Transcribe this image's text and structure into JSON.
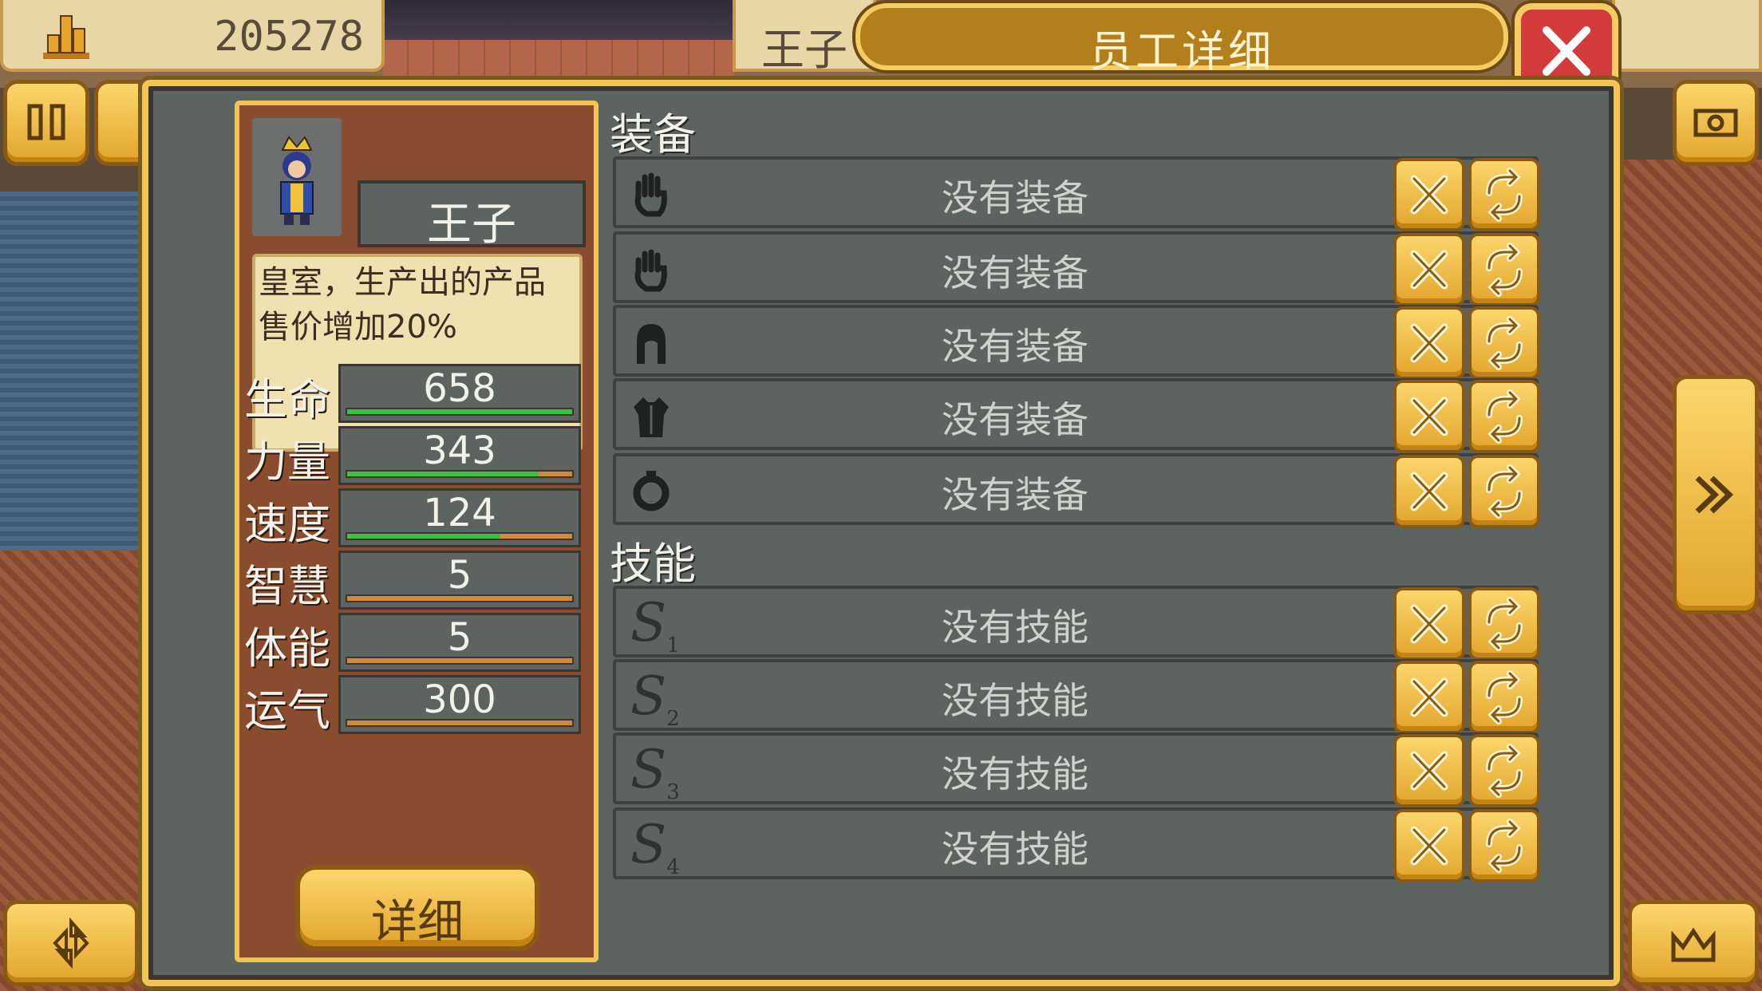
{
  "top_bar": {
    "money": "205278",
    "name_tab": "王子",
    "dialog_title": "员工详细"
  },
  "character": {
    "name": "王子",
    "description": "皇室，生产出的产品售价增加20%",
    "stats": [
      {
        "label": "生命",
        "value": "658",
        "fill": 1.0
      },
      {
        "label": "力量",
        "value": "343",
        "fill": 0.85
      },
      {
        "label": "速度",
        "value": "124",
        "fill": 0.68
      },
      {
        "label": "智慧",
        "value": "5",
        "fill": 0.0
      },
      {
        "label": "体能",
        "value": "5",
        "fill": 0.0
      },
      {
        "label": "运气",
        "value": "300",
        "fill": 0.0
      }
    ],
    "detail_button": "详细"
  },
  "equipment": {
    "title": "装备",
    "slots": [
      {
        "icon": "glove-icon",
        "text": "没有装备"
      },
      {
        "icon": "gauntlet-icon",
        "text": "没有装备"
      },
      {
        "icon": "helmet-icon",
        "text": "没有装备"
      },
      {
        "icon": "armor-icon",
        "text": "没有装备"
      },
      {
        "icon": "ring-icon",
        "text": "没有装备"
      }
    ]
  },
  "skills": {
    "title": "技能",
    "slots": [
      {
        "sub": "1",
        "text": "没有技能"
      },
      {
        "sub": "2",
        "text": "没有技能"
      },
      {
        "sub": "3",
        "text": "没有技能"
      },
      {
        "sub": "4",
        "text": "没有技能"
      }
    ]
  },
  "colors": {
    "gold": "#f0c455",
    "panel": "#5c6360",
    "card": "#8a4c2e",
    "close": "#d33a3a",
    "bar_fill": "#3fbf3f"
  }
}
